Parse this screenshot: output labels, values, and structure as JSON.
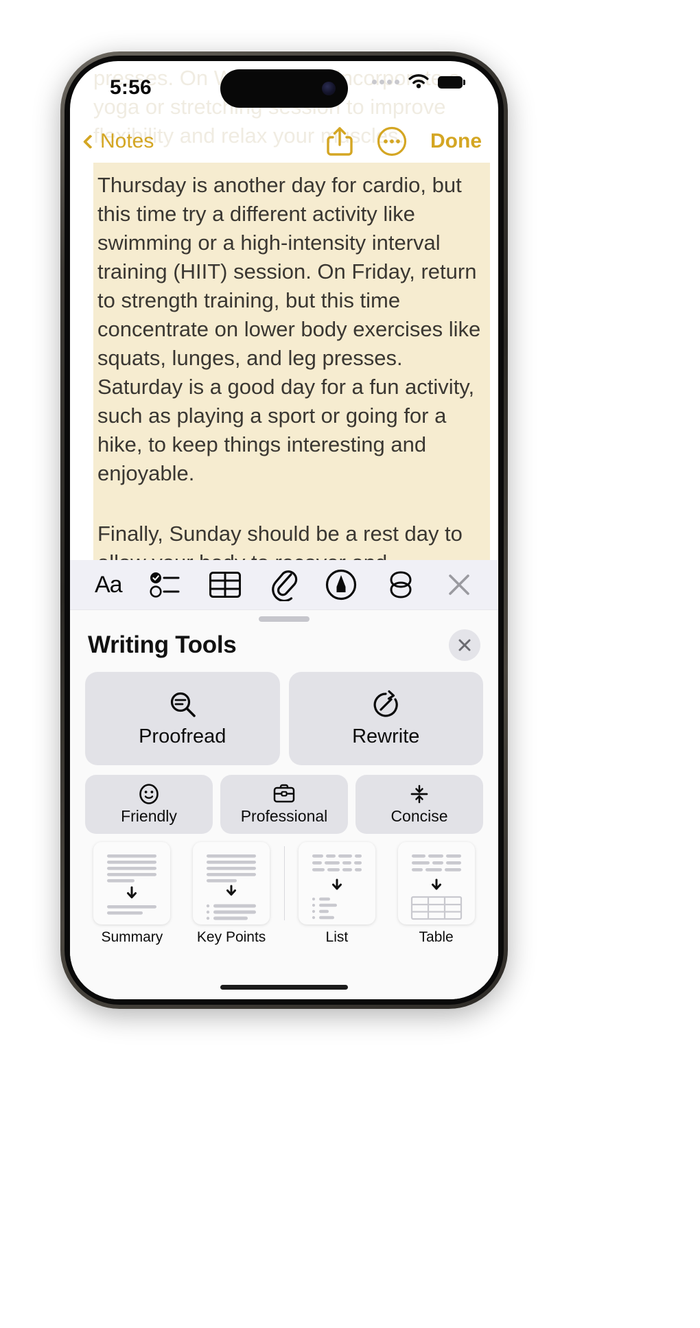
{
  "status_bar": {
    "time": "5:56",
    "wifi_icon": "wifi-icon",
    "battery_icon": "battery-icon",
    "signal_icon": "signal-dots-icon"
  },
  "nav_bar": {
    "back_label": "Notes",
    "back_icon": "chevron-left-icon",
    "share_icon": "share-up-icon",
    "more_icon": "ellipsis-circle-icon",
    "done_label": "Done",
    "accent_color": "#d4a623"
  },
  "note": {
    "ghost_text": "presses. On Wednesday, incorporate a yoga or stretching session to improve flexibility and relax your muscles.",
    "highlight_color": "#f6ecd0",
    "text_color": "#3a3732",
    "paragraphs": [
      "Thursday is another day for cardio, but this time try a different activity like swimming or a high-intensity interval training (HIIT) session. On Friday, return to strength training, but this time concentrate on lower body exercises like squats, lunges, and leg presses. Saturday is a good day for a fun activity, such as playing a sport or going for a hike, to keep things interesting and enjoyable.",
      "Finally, Sunday should be a rest day to allow your body to recover and rejuvenate."
    ],
    "selection_handle": "selection-handle"
  },
  "format_toolbar": {
    "background": "#f0f0f6",
    "items": [
      {
        "name": "format-text-button",
        "label": "Aa",
        "icon": "aa-text-icon"
      },
      {
        "name": "checklist-button",
        "label": "",
        "icon": "checklist-icon"
      },
      {
        "name": "table-button",
        "label": "",
        "icon": "table-icon"
      },
      {
        "name": "attachment-button",
        "label": "",
        "icon": "paperclip-icon"
      },
      {
        "name": "markup-button",
        "label": "",
        "icon": "pen-circle-icon"
      },
      {
        "name": "apple-intelligence-button",
        "label": "",
        "icon": "apple-intelligence-knot-icon"
      },
      {
        "name": "close-toolbar-button",
        "label": "",
        "icon": "close-x-icon"
      }
    ]
  },
  "writing_tools": {
    "title": "Writing Tools",
    "close_icon": "close-x-icon",
    "primary_actions": [
      {
        "label": "Proofread",
        "icon": "magnifier-lines-icon"
      },
      {
        "label": "Rewrite",
        "icon": "rewrite-circle-arrow-icon"
      }
    ],
    "tone_actions": [
      {
        "label": "Friendly",
        "icon": "smiley-face-icon"
      },
      {
        "label": "Professional",
        "icon": "briefcase-icon"
      },
      {
        "label": "Concise",
        "icon": "compress-arrows-icon"
      }
    ],
    "transform_actions": [
      {
        "label": "Summary",
        "icon": "summary-thumb-icon"
      },
      {
        "label": "Key Points",
        "icon": "key-points-thumb-icon"
      },
      {
        "label": "List",
        "icon": "list-thumb-icon"
      },
      {
        "label": "Table",
        "icon": "table-thumb-icon"
      }
    ]
  }
}
